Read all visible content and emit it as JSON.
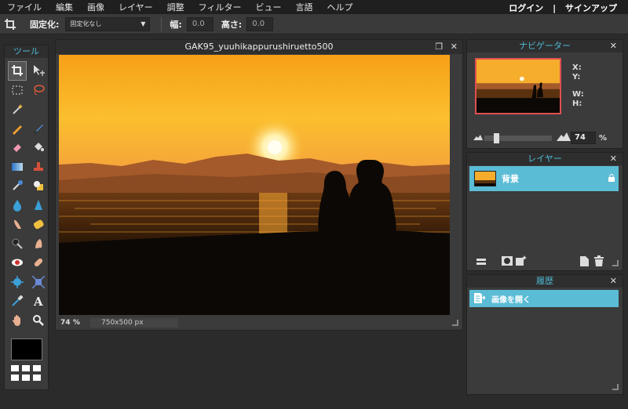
{
  "menu": [
    "ファイル",
    "編集",
    "画像",
    "レイヤー",
    "調整",
    "フィルター",
    "ビュー",
    "言語",
    "ヘルプ"
  ],
  "auth": {
    "login": "ログイン",
    "separator": "|",
    "signup": "サインアップ"
  },
  "options": {
    "constrain_label": "固定化:",
    "constrain_value": "固定化なし",
    "width_label": "幅:",
    "width_value": "0.0",
    "height_label": "高さ:",
    "height_value": "0.0"
  },
  "toolbox": {
    "title": "ツール",
    "tools": [
      "crop-icon",
      "move-icon",
      "marquee-icon",
      "lasso-icon",
      "wand-icon",
      "pencil-icon",
      "brush-icon",
      "eraser-icon",
      "bucket-icon",
      "gradient-icon",
      "stamp-icon",
      "replace-color-icon",
      "drawing-icon",
      "blur-icon",
      "sharpen-icon",
      "smudge-icon",
      "sponge-icon",
      "dodge-icon",
      "burn-icon",
      "redeye-icon",
      "spot-heal-icon",
      "bloat-icon",
      "pinch-icon",
      "color-picker-icon",
      "type-icon",
      "hand-icon",
      "zoom-icon"
    ],
    "primary_color": "#000000"
  },
  "document": {
    "title": "GAK95_yuuhikappurushiruetto500",
    "zoom": "74",
    "zoom_unit": "%",
    "dimensions": "750x500 px"
  },
  "navigator": {
    "title": "ナビゲーター",
    "x_label": "X:",
    "y_label": "Y:",
    "w_label": "W:",
    "h_label": "H:",
    "zoom": "74",
    "zoom_unit": "%"
  },
  "layers": {
    "title": "レイヤー",
    "items": [
      {
        "name": "背景",
        "locked": true
      }
    ]
  },
  "history": {
    "title": "履歴",
    "items": [
      {
        "name": "画像を開く"
      }
    ]
  },
  "colors": {
    "accent": "#5bbcd6",
    "panel_title": "#4fb9d6"
  }
}
